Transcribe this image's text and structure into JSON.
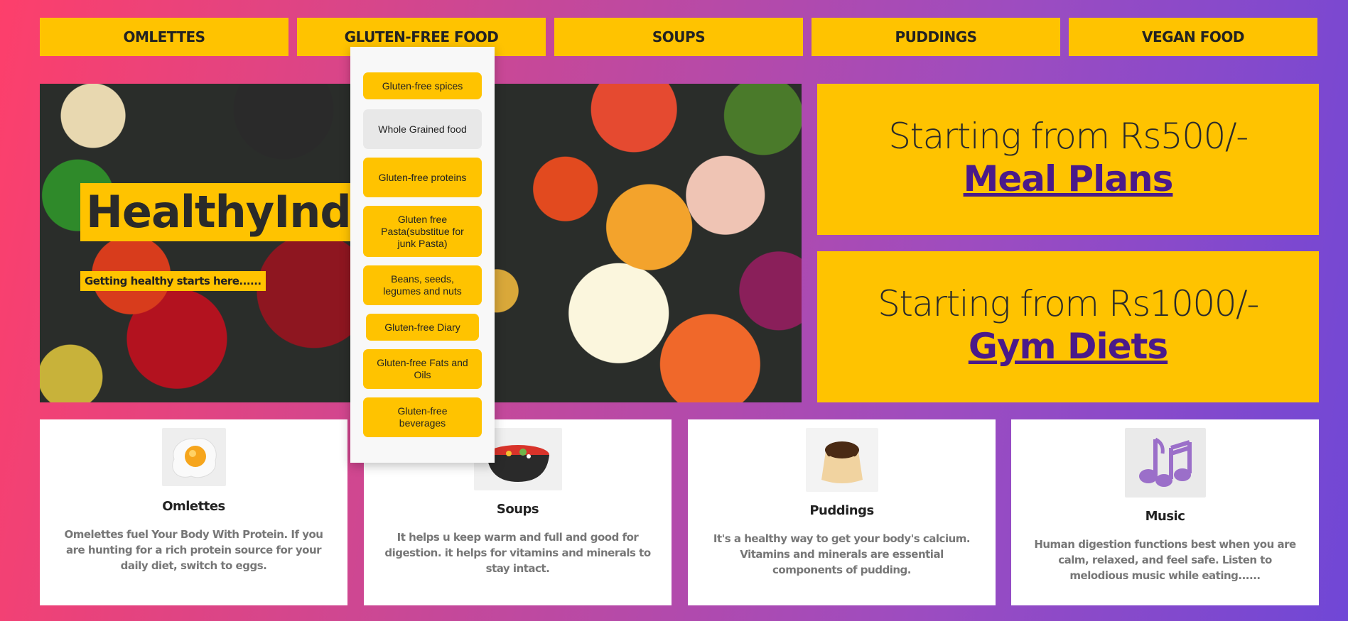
{
  "nav": {
    "items": [
      "OMLETTES",
      "GLUTEN-FREE FOOD",
      "SOUPS",
      "PUDDINGS",
      "VEGAN FOOD"
    ]
  },
  "hero": {
    "title": "HealthyIndia",
    "subtitle": "Getting healthy starts here......"
  },
  "promos": [
    {
      "price": "Starting from Rs500/-",
      "link": "Meal Plans"
    },
    {
      "price": "Starting from Rs1000/-",
      "link": "Gym Diets"
    }
  ],
  "dropdown": {
    "items": [
      "Gluten-free spices",
      "Whole Grained food",
      "Gluten-free proteins",
      "Gluten free Pasta(substitue for junk Pasta)",
      "Beans, seeds, legumes and nuts",
      "Gluten-free Diary",
      "Gluten-free Fats and Oils",
      "Gluten-free beverages"
    ],
    "hovered_index": 1
  },
  "cards": [
    {
      "title": "Omlettes",
      "text": "Omelettes fuel Your Body With Protein. If you are hunting for a rich protein source for your daily diet, switch to eggs.",
      "icon": "egg-icon"
    },
    {
      "title": "Soups",
      "text": "It helps u keep warm and full and good for digestion. it helps for vitamins and minerals to stay intact.",
      "icon": "soup-bowl-icon"
    },
    {
      "title": "Puddings",
      "text": "It's a healthy way to get your body's calcium. Vitamins and minerals are essential components of pudding.",
      "icon": "pudding-icon"
    },
    {
      "title": "Music",
      "text": "Human digestion functions best when you are calm, relaxed, and feel safe. Listen to melodious music while eating......",
      "icon": "music-notes-icon"
    }
  ],
  "colors": {
    "accent": "#ffc300",
    "link": "#4a1a8a",
    "gradient_start": "#fd3f6b",
    "gradient_end": "#7047d6"
  }
}
